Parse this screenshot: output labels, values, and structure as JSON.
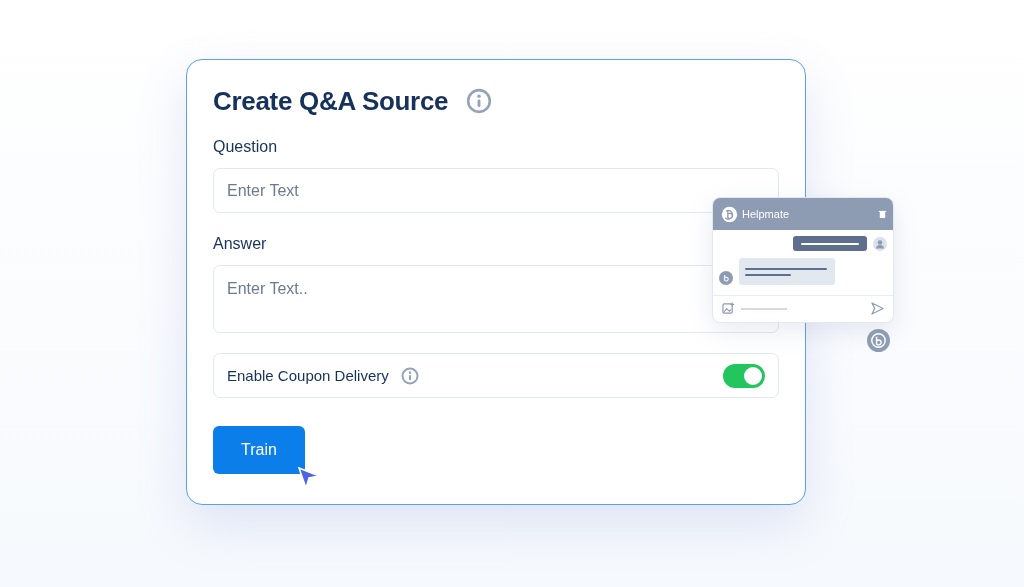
{
  "form": {
    "title": "Create Q&A Source",
    "fields": [
      {
        "kind": "input",
        "label": "Question",
        "placeholder": "Enter Text"
      },
      {
        "kind": "textarea",
        "label": "Answer",
        "placeholder": "Enter Text.."
      }
    ],
    "toggle": {
      "label": "Enable Coupon Delivery",
      "on": true
    },
    "button": "Train"
  },
  "chat_widget": {
    "title": "Helpmate"
  }
}
